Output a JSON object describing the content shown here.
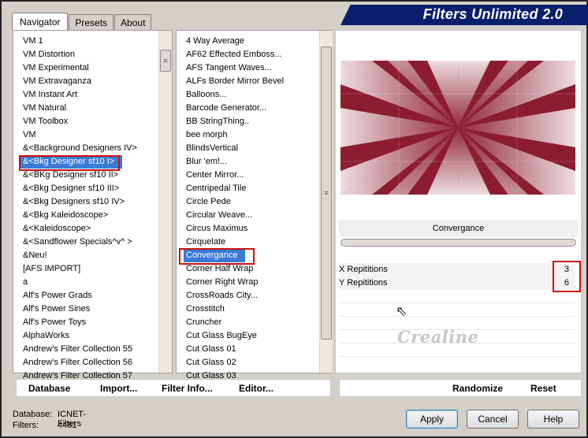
{
  "header": {
    "title": "Filters Unlimited 2.0",
    "banner_color": "#0a1e6e"
  },
  "tabs": [
    {
      "label": "Navigator",
      "active": true
    },
    {
      "label": "Presets",
      "active": false
    },
    {
      "label": "About",
      "active": false
    }
  ],
  "categories": {
    "items": [
      "VM 1",
      "VM Distortion",
      "VM Experimental",
      "VM Extravaganza",
      "VM Instant Art",
      "VM Natural",
      "VM Toolbox",
      "VM",
      "&<Background Designers IV>",
      "&<Bkg Designer sf10 I>",
      "&<BKg Designer sf10 II>",
      "&<Bkg Designer sf10 III>",
      "&<Bkg Designers sf10 IV>",
      "&<Bkg Kaleidoscope>",
      "&<Kaleidoscope>",
      "&<Sandflower Specials^v^ >",
      "&Neu!",
      "[AFS IMPORT]",
      "a",
      "Alf's Power Grads",
      "Alf's Power Sines",
      "Alf's Power Toys",
      "AlphaWorks",
      "Andrew's Filter Collection 55",
      "Andrew's Filter Collection 56",
      "Andrew's Filter Collection 57"
    ],
    "selected": "&<Bkg Designer sf10 I>"
  },
  "filters": {
    "items": [
      "4 Way Average",
      "AF62 Effected Emboss...",
      "AFS Tangent Waves...",
      "ALFs Border Mirror Bevel",
      "Balloons...",
      "Barcode Generator...",
      "BB StringThing..",
      "bee morph",
      "BlindsVertical",
      "Blur 'em!...",
      "Center Mirror...",
      "Centripedal Tile",
      "Circle Pede",
      "Circular Weave...",
      "Circus Maximus",
      "Cirquelate",
      "Convergance",
      "Corner Half Wrap",
      "Corner Right Wrap",
      "CrossRoads City...",
      "Crosstitch",
      "Cruncher",
      "Cut Glass  BugEye",
      "Cut Glass 01",
      "Cut Glass 02",
      "Cut Glass 03"
    ],
    "selected": "Convergance"
  },
  "preview": {
    "filter_name": "Convergance",
    "base_color": "#8c1c30",
    "params": [
      {
        "label": "X Repititions",
        "value": "3"
      },
      {
        "label": "Y Repititions",
        "value": "6"
      }
    ],
    "watermark": "Crealine"
  },
  "toolbar_left": {
    "database": "Database",
    "import": "Import...",
    "filter_info": "Filter Info...",
    "editor": "Editor..."
  },
  "toolbar_right": {
    "randomize": "Randomize",
    "reset": "Reset"
  },
  "status": {
    "database_label": "Database:",
    "database_value": "ICNET-Filters",
    "filters_label": "Filters:",
    "filters_value": "4481"
  },
  "buttons": {
    "apply": "Apply",
    "cancel": "Cancel",
    "help": "Help"
  }
}
